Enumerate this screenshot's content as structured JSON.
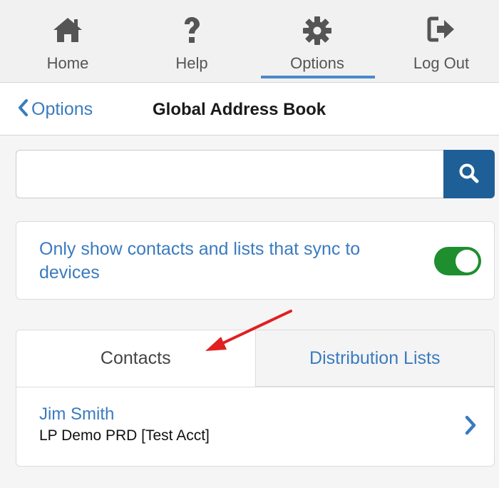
{
  "nav": {
    "items": [
      {
        "label": "Home",
        "icon": "home-icon"
      },
      {
        "label": "Help",
        "icon": "help-icon"
      },
      {
        "label": "Options",
        "icon": "gear-icon"
      },
      {
        "label": "Log Out",
        "icon": "logout-icon"
      }
    ],
    "active": "Options"
  },
  "header": {
    "back_label": "Options",
    "title": "Global Address Book"
  },
  "search": {
    "value": "",
    "placeholder": ""
  },
  "sync_filter": {
    "label": "Only show contacts and lists that sync to devices",
    "enabled": true
  },
  "tabs": [
    {
      "label": "Contacts",
      "selected": true
    },
    {
      "label": "Distribution Lists",
      "selected": false
    }
  ],
  "contacts": [
    {
      "name": "Jim Smith",
      "account": "LP Demo PRD [Test Acct]"
    }
  ],
  "colors": {
    "accent": "#3a7bbf",
    "nav_underline": "#4a8ac9",
    "search_button": "#1f5f97",
    "toggle_on": "#1e8e2f",
    "annotation_arrow": "#e02020"
  }
}
